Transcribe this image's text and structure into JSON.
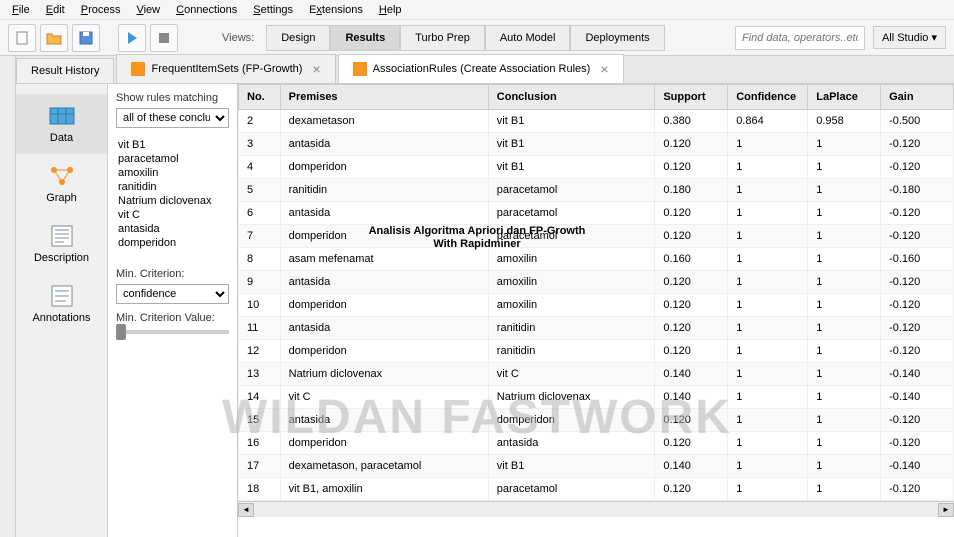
{
  "menu": [
    "File",
    "Edit",
    "Process",
    "View",
    "Connections",
    "Settings",
    "Extensions",
    "Help"
  ],
  "toolbar": {
    "views_label": "Views:",
    "search_placeholder": "Find data, operators..etc",
    "studio_label": "All Studio ▾"
  },
  "view_buttons": [
    "Design",
    "Results",
    "Turbo Prep",
    "Auto Model",
    "Deployments"
  ],
  "active_view": "Results",
  "tabs": [
    {
      "label": "Result History",
      "closable": false,
      "icon": false
    },
    {
      "label": "FrequentItemSets (FP-Growth)",
      "closable": true,
      "icon": true
    },
    {
      "label": "AssociationRules (Create Association Rules)",
      "closable": true,
      "icon": true
    }
  ],
  "active_tab": 2,
  "side_nav": [
    "Data",
    "Graph",
    "Description",
    "Annotations"
  ],
  "active_side": 0,
  "filter": {
    "show_label": "Show rules matching",
    "select_value": "all of these conclusions:",
    "items": [
      "vit B1",
      "paracetamol",
      "amoxilin",
      "ranitidin",
      "Natrium diclovenax",
      "vit C",
      "antasida",
      "domperidon"
    ],
    "min_crit_label": "Min. Criterion:",
    "min_crit_value": "confidence",
    "min_val_label": "Min. Criterion Value:"
  },
  "columns": [
    "No.",
    "Premises",
    "Conclusion",
    "Support",
    "Confidence",
    "LaPlace",
    "Gain"
  ],
  "rows": [
    {
      "no": "2",
      "premises": "dexametason",
      "conclusion": "vit B1",
      "support": "0.380",
      "confidence": "0.864",
      "laplace": "0.958",
      "gain": "-0.500"
    },
    {
      "no": "3",
      "premises": "antasida",
      "conclusion": "vit B1",
      "support": "0.120",
      "confidence": "1",
      "laplace": "1",
      "gain": "-0.120"
    },
    {
      "no": "4",
      "premises": "domperidon",
      "conclusion": "vit B1",
      "support": "0.120",
      "confidence": "1",
      "laplace": "1",
      "gain": "-0.120"
    },
    {
      "no": "5",
      "premises": "ranitidin",
      "conclusion": "paracetamol",
      "support": "0.180",
      "confidence": "1",
      "laplace": "1",
      "gain": "-0.180"
    },
    {
      "no": "6",
      "premises": "antasida",
      "conclusion": "paracetamol",
      "support": "0.120",
      "confidence": "1",
      "laplace": "1",
      "gain": "-0.120"
    },
    {
      "no": "7",
      "premises": "domperidon",
      "conclusion": "paracetamol",
      "support": "0.120",
      "confidence": "1",
      "laplace": "1",
      "gain": "-0.120"
    },
    {
      "no": "8",
      "premises": "asam mefenamat",
      "conclusion": "amoxilin",
      "support": "0.160",
      "confidence": "1",
      "laplace": "1",
      "gain": "-0.160"
    },
    {
      "no": "9",
      "premises": "antasida",
      "conclusion": "amoxilin",
      "support": "0.120",
      "confidence": "1",
      "laplace": "1",
      "gain": "-0.120"
    },
    {
      "no": "10",
      "premises": "domperidon",
      "conclusion": "amoxilin",
      "support": "0.120",
      "confidence": "1",
      "laplace": "1",
      "gain": "-0.120"
    },
    {
      "no": "11",
      "premises": "antasida",
      "conclusion": "ranitidin",
      "support": "0.120",
      "confidence": "1",
      "laplace": "1",
      "gain": "-0.120"
    },
    {
      "no": "12",
      "premises": "domperidon",
      "conclusion": "ranitidin",
      "support": "0.120",
      "confidence": "1",
      "laplace": "1",
      "gain": "-0.120"
    },
    {
      "no": "13",
      "premises": "Natrium diclovenax",
      "conclusion": "vit C",
      "support": "0.140",
      "confidence": "1",
      "laplace": "1",
      "gain": "-0.140"
    },
    {
      "no": "14",
      "premises": "vit C",
      "conclusion": "Natrium diclovenax",
      "support": "0.140",
      "confidence": "1",
      "laplace": "1",
      "gain": "-0.140"
    },
    {
      "no": "15",
      "premises": "antasida",
      "conclusion": "domperidon",
      "support": "0.120",
      "confidence": "1",
      "laplace": "1",
      "gain": "-0.120"
    },
    {
      "no": "16",
      "premises": "domperidon",
      "conclusion": "antasida",
      "support": "0.120",
      "confidence": "1",
      "laplace": "1",
      "gain": "-0.120"
    },
    {
      "no": "17",
      "premises": "dexametason, paracetamol",
      "conclusion": "vit B1",
      "support": "0.140",
      "confidence": "1",
      "laplace": "1",
      "gain": "-0.140"
    },
    {
      "no": "18",
      "premises": "vit B1, amoxilin",
      "conclusion": "paracetamol",
      "support": "0.120",
      "confidence": "1",
      "laplace": "1",
      "gain": "-0.120"
    }
  ],
  "overlay": {
    "title_line1": "Analisis Algoritma Apriori dan FP-Growth",
    "title_line2": "With Rapidminer",
    "watermark": "WILDAN FASTWORK"
  }
}
